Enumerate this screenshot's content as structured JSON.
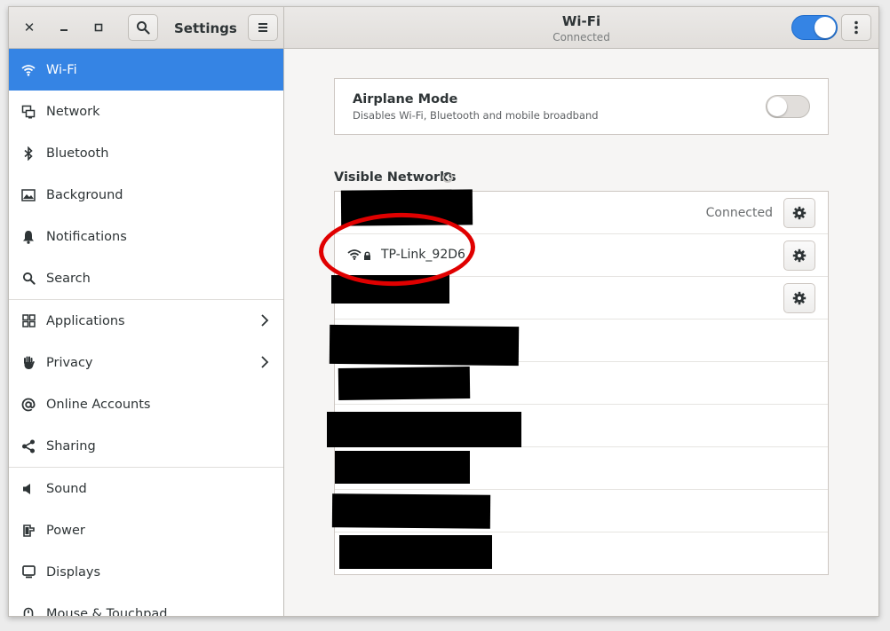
{
  "header": {
    "app_title": "Settings",
    "page_title": "Wi-Fi",
    "page_subtitle": "Connected",
    "wifi_enabled": true
  },
  "sidebar": {
    "items": [
      {
        "label": "Wi-Fi",
        "icon": "wifi-icon"
      },
      {
        "label": "Network",
        "icon": "network-icon"
      },
      {
        "label": "Bluetooth",
        "icon": "bluetooth-icon"
      },
      {
        "label": "Background",
        "icon": "background-icon"
      },
      {
        "label": "Notifications",
        "icon": "bell-icon"
      },
      {
        "label": "Search",
        "icon": "search-icon"
      },
      {
        "label": "Applications",
        "icon": "applications-icon"
      },
      {
        "label": "Privacy",
        "icon": "hand-icon"
      },
      {
        "label": "Online Accounts",
        "icon": "at-icon"
      },
      {
        "label": "Sharing",
        "icon": "share-icon"
      },
      {
        "label": "Sound",
        "icon": "speaker-icon"
      },
      {
        "label": "Power",
        "icon": "power-icon"
      },
      {
        "label": "Displays",
        "icon": "display-icon"
      },
      {
        "label": "Mouse & Touchpad",
        "icon": "mouse-icon"
      }
    ]
  },
  "airplane": {
    "title": "Airplane Mode",
    "description": "Disables Wi-Fi, Bluetooth and mobile broadband",
    "enabled": false
  },
  "networks": {
    "title": "Visible Networks",
    "rows": [
      {
        "name": "",
        "status": "Connected",
        "redacted": true
      },
      {
        "name": "TP-Link_92D6",
        "status": "",
        "redacted": false
      },
      {
        "name": "",
        "status": "",
        "redacted": true
      },
      {
        "name": "",
        "status": "",
        "redacted": true
      },
      {
        "name": "",
        "status": "",
        "redacted": true
      },
      {
        "name": "",
        "status": "",
        "redacted": true
      },
      {
        "name": "",
        "status": "",
        "redacted": true
      },
      {
        "name": "",
        "status": "",
        "redacted": true
      },
      {
        "name": "",
        "status": "",
        "redacted": true
      }
    ]
  },
  "colors": {
    "accent": "#3584e4",
    "annotation_circle": "#e00000"
  }
}
